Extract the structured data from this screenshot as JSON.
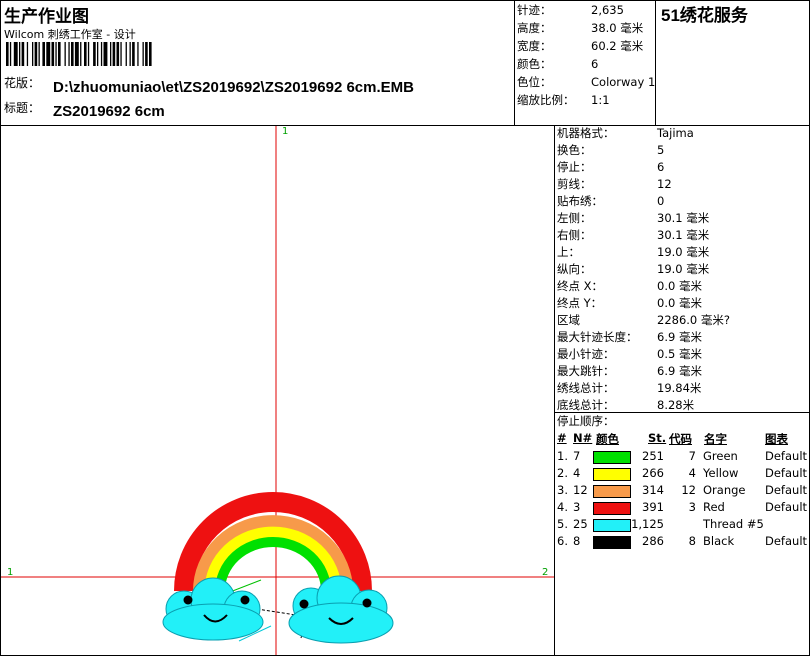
{
  "header": {
    "title": "生产作业图",
    "subtitle": "Wilcom 刺绣工作室 - 设计",
    "design_label": "花版：",
    "design_path": "D:\\zhuomuniao\\et\\ZS2019692\\ZS2019692 6cm.EMB",
    "title_label": "标题：",
    "title_value": "ZS2019692 6cm"
  },
  "summary": [
    {
      "label": "针迹：",
      "value": "2,635"
    },
    {
      "label": "高度：",
      "value": "38.0 毫米"
    },
    {
      "label": "宽度：",
      "value": "60.2 毫米"
    },
    {
      "label": "颜色：",
      "value": "6"
    },
    {
      "label": "色位：",
      "value": "Colorway 1"
    },
    {
      "label": "缩放比例：",
      "value": "1:1"
    }
  ],
  "brand": "51绣花服务",
  "canvas": {
    "marker_top": "1",
    "marker_left": "1",
    "marker_right": "2",
    "guide_color": "#e00000"
  },
  "machine_stats": [
    {
      "label": "机器格式：",
      "value": "Tajima"
    },
    {
      "label": "换色：",
      "value": "5"
    },
    {
      "label": "停止：",
      "value": "6"
    },
    {
      "label": "剪线：",
      "value": "12"
    },
    {
      "label": "贴布绣：",
      "value": "0"
    },
    {
      "label": "左侧：",
      "value": "30.1 毫米"
    },
    {
      "label": "右侧：",
      "value": "30.1 毫米"
    },
    {
      "label": "上：",
      "value": "19.0 毫米"
    },
    {
      "label": "纵向：",
      "value": "19.0 毫米"
    },
    {
      "label": "终点 X：",
      "value": "0.0 毫米"
    },
    {
      "label": "终点 Y：",
      "value": "0.0 毫米"
    },
    {
      "label": "区域",
      "value": "2286.0 毫米?"
    },
    {
      "label": "最大针迹长度：",
      "value": "6.9 毫米"
    },
    {
      "label": "最小针迹：",
      "value": "0.5 毫米"
    },
    {
      "label": "最大跳针：",
      "value": "6.9 毫米"
    },
    {
      "label": "绣线总计：",
      "value": "19.84米"
    },
    {
      "label": "底线总计：",
      "value": "8.28米"
    }
  ],
  "stop_sequence": {
    "heading": "停止顺序：",
    "columns": {
      "index": "#",
      "needle": "N#",
      "color": "颜色",
      "stitches": "St.",
      "code": "代码",
      "name": "名字",
      "chart": "图表"
    },
    "rows": [
      {
        "index": "1.",
        "needle": "7",
        "color": "#00e000",
        "stitches": "251",
        "code": "7",
        "name": "Green",
        "chart": "Default"
      },
      {
        "index": "2.",
        "needle": "4",
        "color": "#ffff00",
        "stitches": "266",
        "code": "4",
        "name": "Yellow",
        "chart": "Default"
      },
      {
        "index": "3.",
        "needle": "12",
        "color": "#f79a4a",
        "stitches": "314",
        "code": "12",
        "name": "Orange",
        "chart": "Default"
      },
      {
        "index": "4.",
        "needle": "3",
        "color": "#ee1111",
        "stitches": "391",
        "code": "3",
        "name": "Red",
        "chart": "Default"
      },
      {
        "index": "5.",
        "needle": "25",
        "color": "#22f0f8",
        "stitches": "1,125",
        "code": "",
        "name": "Thread #5",
        "chart": ""
      },
      {
        "index": "6.",
        "needle": "8",
        "color": "#000000",
        "stitches": "286",
        "code": "8",
        "name": "Black",
        "chart": "Default"
      }
    ]
  }
}
